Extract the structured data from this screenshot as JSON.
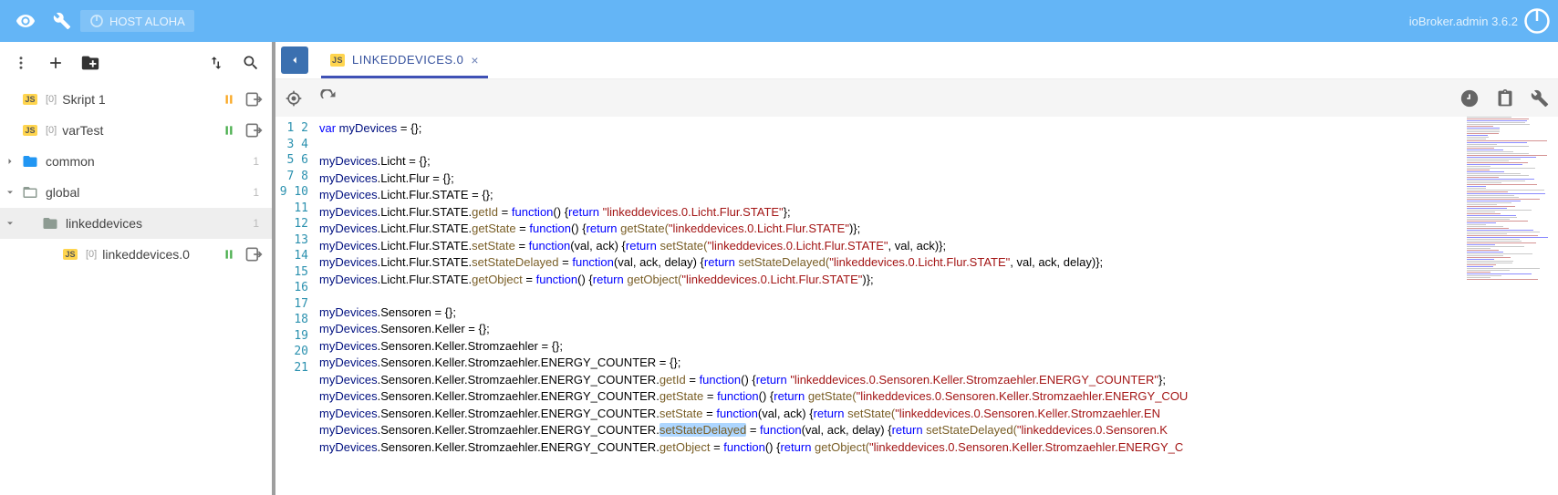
{
  "topbar": {
    "host_label": "HOST ALOHA",
    "version": "ioBroker.admin 3.6.2"
  },
  "sidebar": {
    "items": [
      {
        "type": "script",
        "inst": "[0]",
        "label": "Skript 1",
        "pause": "orange"
      },
      {
        "type": "script",
        "inst": "[0]",
        "label": "varTest",
        "pause": "green"
      },
      {
        "type": "folder",
        "label": "common",
        "count": "1",
        "chev": "right",
        "style": "blue",
        "indent": 0
      },
      {
        "type": "folder",
        "label": "global",
        "count": "1",
        "chev": "down",
        "style": "open",
        "indent": 0
      },
      {
        "type": "folder",
        "label": "linkeddevices",
        "count": "1",
        "chev": "down",
        "style": "grey",
        "indent": 1,
        "sel": true
      },
      {
        "type": "script",
        "inst": "[0]",
        "label": "linkeddevices.0",
        "pause": "green",
        "indent": 2
      }
    ]
  },
  "tab": {
    "title": "LINKEDDEVICES.0"
  },
  "code": {
    "highlight_token": "setStateDelayed",
    "lines": [
      [
        {
          "t": "var ",
          "c": "k"
        },
        {
          "t": "myDevices",
          "c": "v"
        },
        {
          "t": " = {};",
          "c": "o"
        }
      ],
      [],
      [
        {
          "t": "myDevices",
          "c": "v"
        },
        {
          "t": ".Licht = {};",
          "c": "o"
        }
      ],
      [
        {
          "t": "myDevices",
          "c": "v"
        },
        {
          "t": ".Licht.Flur = {};",
          "c": "o"
        }
      ],
      [
        {
          "t": "myDevices",
          "c": "v"
        },
        {
          "t": ".Licht.Flur.STATE = {};",
          "c": "o"
        }
      ],
      [
        {
          "t": "myDevices",
          "c": "v"
        },
        {
          "t": ".Licht.Flur.STATE.",
          "c": "o"
        },
        {
          "t": "getId",
          "c": "f"
        },
        {
          "t": " = ",
          "c": "o"
        },
        {
          "t": "function",
          "c": "k"
        },
        {
          "t": "() {",
          "c": "o"
        },
        {
          "t": "return ",
          "c": "k"
        },
        {
          "t": "\"linkeddevices.0.Licht.Flur.STATE\"",
          "c": "s"
        },
        {
          "t": "};",
          "c": "o"
        }
      ],
      [
        {
          "t": "myDevices",
          "c": "v"
        },
        {
          "t": ".Licht.Flur.STATE.",
          "c": "o"
        },
        {
          "t": "getState",
          "c": "f"
        },
        {
          "t": " = ",
          "c": "o"
        },
        {
          "t": "function",
          "c": "k"
        },
        {
          "t": "() {",
          "c": "o"
        },
        {
          "t": "return ",
          "c": "k"
        },
        {
          "t": "getState(",
          "c": "f"
        },
        {
          "t": "\"linkeddevices.0.Licht.Flur.STATE\"",
          "c": "s"
        },
        {
          "t": ")};",
          "c": "o"
        }
      ],
      [
        {
          "t": "myDevices",
          "c": "v"
        },
        {
          "t": ".Licht.Flur.STATE.",
          "c": "o"
        },
        {
          "t": "setState",
          "c": "f"
        },
        {
          "t": " = ",
          "c": "o"
        },
        {
          "t": "function",
          "c": "k"
        },
        {
          "t": "(val, ack) {",
          "c": "o"
        },
        {
          "t": "return ",
          "c": "k"
        },
        {
          "t": "setState(",
          "c": "f"
        },
        {
          "t": "\"linkeddevices.0.Licht.Flur.STATE\"",
          "c": "s"
        },
        {
          "t": ", val, ack)};",
          "c": "o"
        }
      ],
      [
        {
          "t": "myDevices",
          "c": "v"
        },
        {
          "t": ".Licht.Flur.STATE.",
          "c": "o"
        },
        {
          "t": "setStateDelayed",
          "c": "f"
        },
        {
          "t": " = ",
          "c": "o"
        },
        {
          "t": "function",
          "c": "k"
        },
        {
          "t": "(val, ack, delay) {",
          "c": "o"
        },
        {
          "t": "return ",
          "c": "k"
        },
        {
          "t": "setStateDelayed(",
          "c": "f"
        },
        {
          "t": "\"linkeddevices.0.Licht.Flur.STATE\"",
          "c": "s"
        },
        {
          "t": ", val, ack, delay)};",
          "c": "o"
        }
      ],
      [
        {
          "t": "myDevices",
          "c": "v"
        },
        {
          "t": ".Licht.Flur.STATE.",
          "c": "o"
        },
        {
          "t": "getObject",
          "c": "f"
        },
        {
          "t": " = ",
          "c": "o"
        },
        {
          "t": "function",
          "c": "k"
        },
        {
          "t": "() {",
          "c": "o"
        },
        {
          "t": "return ",
          "c": "k"
        },
        {
          "t": "getObject(",
          "c": "f"
        },
        {
          "t": "\"linkeddevices.0.Licht.Flur.STATE\"",
          "c": "s"
        },
        {
          "t": ")};",
          "c": "o"
        }
      ],
      [],
      [
        {
          "t": "myDevices",
          "c": "v"
        },
        {
          "t": ".Sensoren = {};",
          "c": "o"
        }
      ],
      [
        {
          "t": "myDevices",
          "c": "v"
        },
        {
          "t": ".Sensoren.Keller = {};",
          "c": "o"
        }
      ],
      [
        {
          "t": "myDevices",
          "c": "v"
        },
        {
          "t": ".Sensoren.Keller.Stromzaehler = {};",
          "c": "o"
        }
      ],
      [
        {
          "t": "myDevices",
          "c": "v"
        },
        {
          "t": ".Sensoren.Keller.Stromzaehler.ENERGY_COUNTER = {};",
          "c": "o"
        }
      ],
      [
        {
          "t": "myDevices",
          "c": "v"
        },
        {
          "t": ".Sensoren.Keller.Stromzaehler.ENERGY_COUNTER.",
          "c": "o"
        },
        {
          "t": "getId",
          "c": "f"
        },
        {
          "t": " = ",
          "c": "o"
        },
        {
          "t": "function",
          "c": "k"
        },
        {
          "t": "() {",
          "c": "o"
        },
        {
          "t": "return ",
          "c": "k"
        },
        {
          "t": "\"linkeddevices.0.Sensoren.Keller.Stromzaehler.ENERGY_COUNTER\"",
          "c": "s"
        },
        {
          "t": "};",
          "c": "o"
        }
      ],
      [
        {
          "t": "myDevices",
          "c": "v"
        },
        {
          "t": ".Sensoren.Keller.Stromzaehler.ENERGY_COUNTER.",
          "c": "o"
        },
        {
          "t": "getState",
          "c": "f"
        },
        {
          "t": " = ",
          "c": "o"
        },
        {
          "t": "function",
          "c": "k"
        },
        {
          "t": "() {",
          "c": "o"
        },
        {
          "t": "return ",
          "c": "k"
        },
        {
          "t": "getState(",
          "c": "f"
        },
        {
          "t": "\"linkeddevices.0.Sensoren.Keller.Stromzaehler.ENERGY_COU",
          "c": "s"
        }
      ],
      [
        {
          "t": "myDevices",
          "c": "v"
        },
        {
          "t": ".Sensoren.Keller.Stromzaehler.ENERGY_COUNTER.",
          "c": "o"
        },
        {
          "t": "setState",
          "c": "f"
        },
        {
          "t": " = ",
          "c": "o"
        },
        {
          "t": "function",
          "c": "k"
        },
        {
          "t": "(val, ack) {",
          "c": "o"
        },
        {
          "t": "return ",
          "c": "k"
        },
        {
          "t": "setState(",
          "c": "f"
        },
        {
          "t": "\"linkeddevices.0.Sensoren.Keller.Stromzaehler.EN",
          "c": "s"
        }
      ],
      [
        {
          "t": "myDevices",
          "c": "v"
        },
        {
          "t": ".Sensoren.Keller.Stromzaehler.ENERGY_COUNTER.",
          "c": "o"
        },
        {
          "t": "setStateDelayed",
          "c": "f",
          "hl": true
        },
        {
          "t": " = ",
          "c": "o"
        },
        {
          "t": "function",
          "c": "k"
        },
        {
          "t": "(val, ack, delay) {",
          "c": "o"
        },
        {
          "t": "return ",
          "c": "k"
        },
        {
          "t": "setStateDelayed(",
          "c": "f"
        },
        {
          "t": "\"linkeddevices.0.Sensoren.K",
          "c": "s"
        }
      ],
      [
        {
          "t": "myDevices",
          "c": "v"
        },
        {
          "t": ".Sensoren.Keller.Stromzaehler.ENERGY_COUNTER.",
          "c": "o"
        },
        {
          "t": "getObject",
          "c": "f"
        },
        {
          "t": " = ",
          "c": "o"
        },
        {
          "t": "function",
          "c": "k"
        },
        {
          "t": "() {",
          "c": "o"
        },
        {
          "t": "return ",
          "c": "k"
        },
        {
          "t": "getObject(",
          "c": "f"
        },
        {
          "t": "\"linkeddevices.0.Sensoren.Keller.Stromzaehler.ENERGY_C",
          "c": "s"
        }
      ],
      []
    ]
  }
}
